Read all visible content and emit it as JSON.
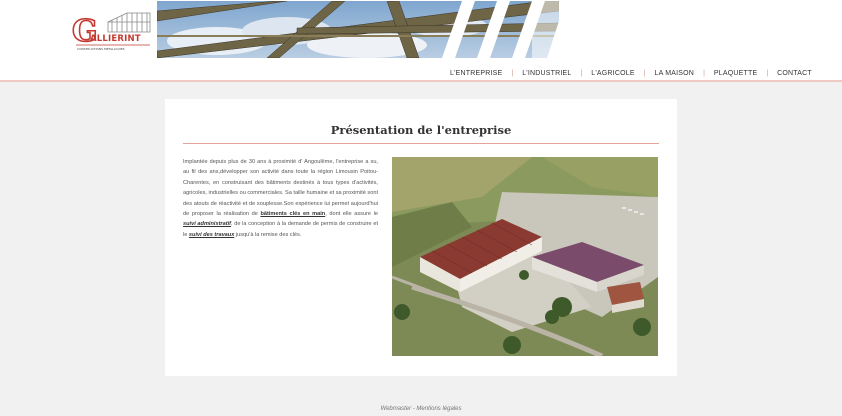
{
  "header": {
    "logo_text": "GALLIERINT",
    "logo_subtitle": "CONSTRUCTIONS MÉTALLIQUES"
  },
  "nav": {
    "items": [
      "L'ENTREPRISE",
      "L'INDUSTRIEL",
      "L'AGRICOLE",
      "LA MAISON",
      "PLAQUETTE",
      "CONTACT"
    ],
    "separator": "|"
  },
  "main": {
    "title": "Présentation de l'entreprise",
    "intro": {
      "part1": "Implantée depuis plus de 30 ans à proximité d' Angoulême, l'entreprise a su, au fil des ans,développer son activité dans toute la région Limousin Poitou-Charentes, en construisant des bâtiments destinés à tous types d'activités, agricoles, industrielles ou commerciales. Sa taille humaine et sa proximité sont des atouts de réactivité et de souplesse.Son expérience lui permet aujourd'hui de proposer la réalisation de ",
      "link1": "bâtiments clés en main",
      "part2": ", dont elle assure le ",
      "link2": "suivi administratif",
      "part3": ", de la conception à la demande de permis de construire et le ",
      "link3": "suivi des travaux",
      "part4": " jusqu'à la remise des clés."
    }
  },
  "footer": {
    "text": "Webmaster - Mentions légales"
  }
}
